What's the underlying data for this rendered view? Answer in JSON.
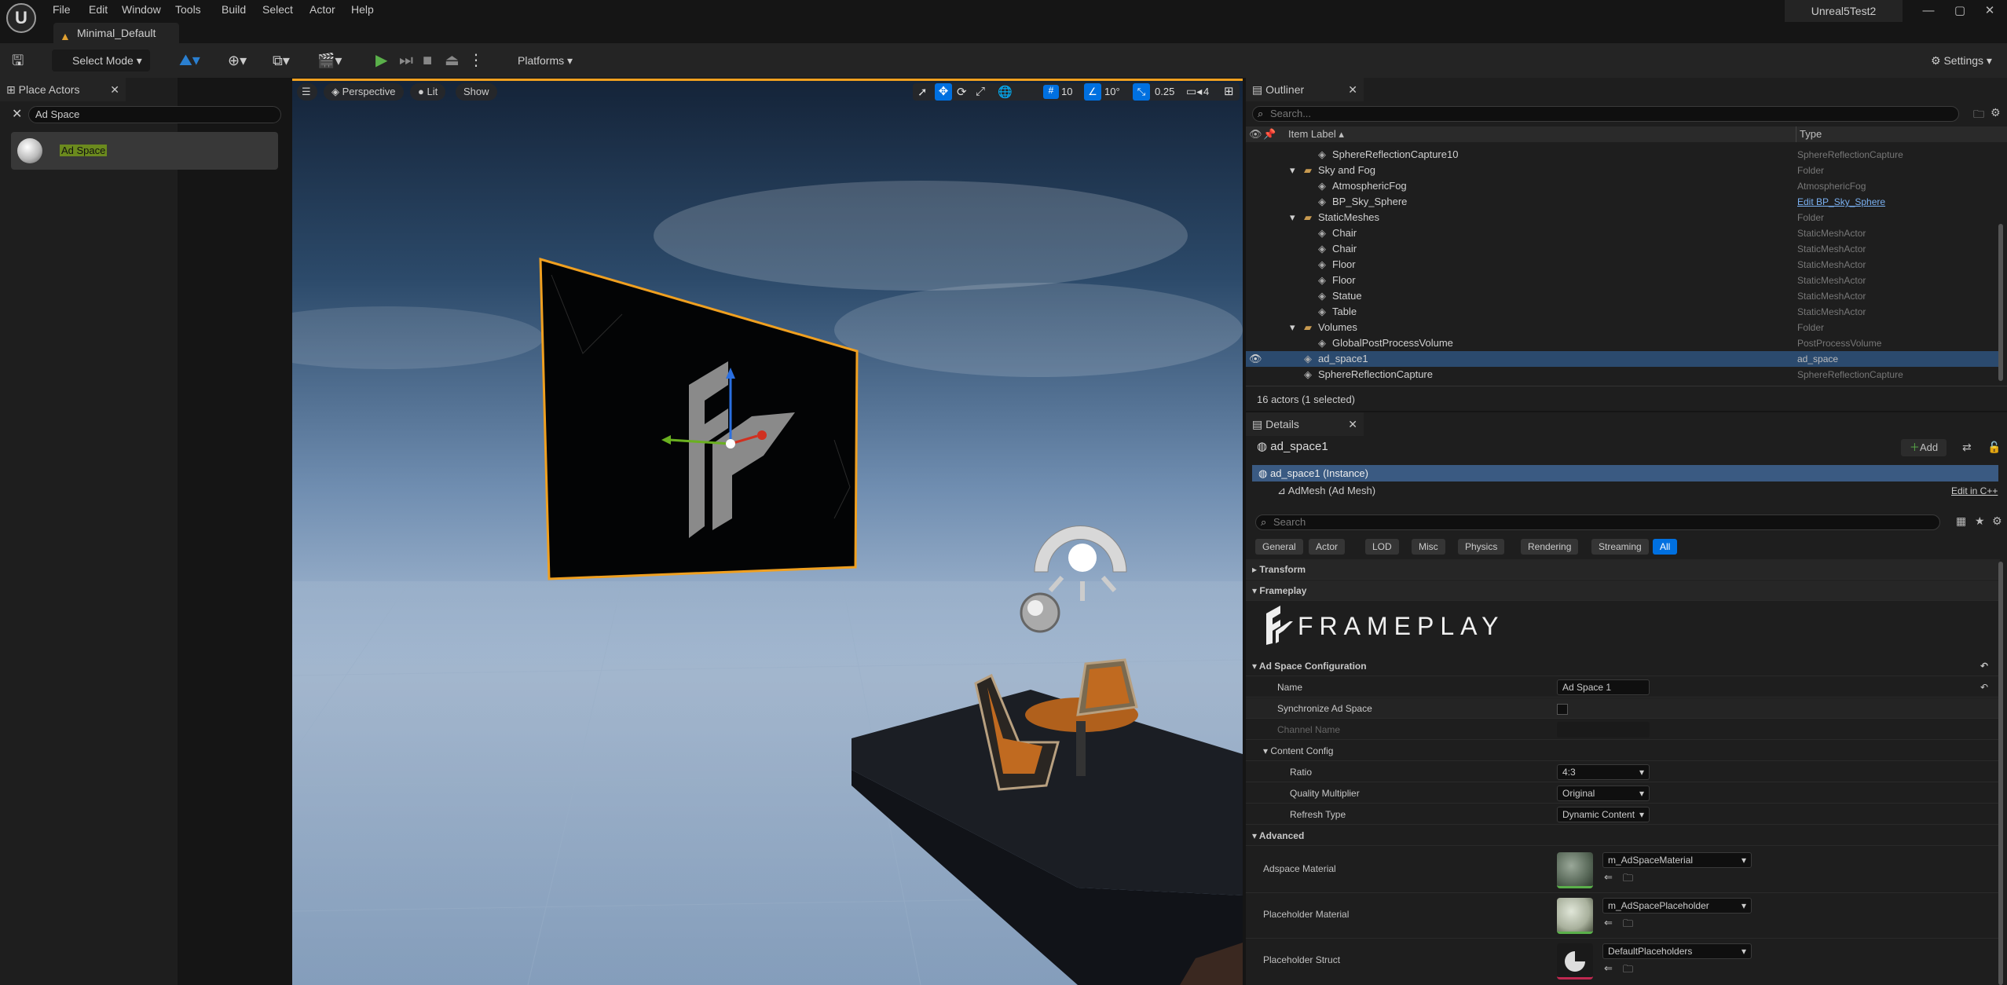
{
  "app": {
    "title": "Unreal5Test2",
    "document_tab": "Minimal_Default"
  },
  "menu": [
    "File",
    "Edit",
    "Window",
    "Tools",
    "Build",
    "Select",
    "Actor",
    "Help"
  ],
  "window_controls": {
    "minimize": "—",
    "maximize": "▢",
    "close": "✕"
  },
  "toolbar": {
    "select_mode": "Select Mode",
    "platforms": "Platforms",
    "settings": "Settings"
  },
  "place_actors": {
    "tab_label": "Place Actors",
    "search_value": "Ad Space",
    "results": [
      {
        "label": "Ad Space"
      }
    ]
  },
  "viewport": {
    "perspective": "Perspective",
    "lit": "Lit",
    "show": "Show",
    "grid_snap": "10",
    "rotation_snap": "10°",
    "scale_snap": "0.25",
    "camera_speed": "4"
  },
  "outliner": {
    "tab_label": "Outliner",
    "search_placeholder": "Search...",
    "col_label": "Item Label ▴",
    "col_type": "Type",
    "rows": [
      {
        "label": "SphereReflectionCapture10",
        "type": "SphereReflectionCapture",
        "depth": 2,
        "kind": "actor"
      },
      {
        "label": "Sky and Fog",
        "type": "Folder",
        "depth": 1,
        "kind": "folder"
      },
      {
        "label": "AtmosphericFog",
        "type": "AtmosphericFog",
        "depth": 2,
        "kind": "actor"
      },
      {
        "label": "BP_Sky_Sphere",
        "type": "Edit BP_Sky_Sphere",
        "depth": 2,
        "kind": "actor",
        "type_link": true
      },
      {
        "label": "StaticMeshes",
        "type": "Folder",
        "depth": 1,
        "kind": "folder"
      },
      {
        "label": "Chair",
        "type": "StaticMeshActor",
        "depth": 2,
        "kind": "actor"
      },
      {
        "label": "Chair",
        "type": "StaticMeshActor",
        "depth": 2,
        "kind": "actor"
      },
      {
        "label": "Floor",
        "type": "StaticMeshActor",
        "depth": 2,
        "kind": "actor"
      },
      {
        "label": "Floor",
        "type": "StaticMeshActor",
        "depth": 2,
        "kind": "actor"
      },
      {
        "label": "Statue",
        "type": "StaticMeshActor",
        "depth": 2,
        "kind": "actor"
      },
      {
        "label": "Table",
        "type": "StaticMeshActor",
        "depth": 2,
        "kind": "actor"
      },
      {
        "label": "Volumes",
        "type": "Folder",
        "depth": 1,
        "kind": "folder"
      },
      {
        "label": "GlobalPostProcessVolume",
        "type": "PostProcessVolume",
        "depth": 2,
        "kind": "actor"
      },
      {
        "label": "ad_space1",
        "type": "ad_space",
        "depth": 1,
        "kind": "actor",
        "selected": true
      },
      {
        "label": "SphereReflectionCapture",
        "type": "SphereReflectionCapture",
        "depth": 1,
        "kind": "actor"
      }
    ],
    "status": "16 actors (1 selected)"
  },
  "details": {
    "tab_label": "Details",
    "actor_name": "ad_space1",
    "add_label": "Add",
    "instance_label": "ad_space1 (Instance)",
    "component_label": "AdMesh (Ad Mesh)",
    "edit_cpp": "Edit in C++",
    "search_placeholder": "Search",
    "categories": [
      "General",
      "Actor",
      "LOD",
      "Misc",
      "Physics",
      "Rendering",
      "Streaming",
      "All"
    ],
    "active_category": "All",
    "sections": {
      "transform": "Transform",
      "frameplay": "Frameplay",
      "ad_space_config": "Ad Space Configuration",
      "content_config": "Content Config",
      "advanced": "Advanced"
    },
    "frameplay_logo_text": "FRAMEPLAY",
    "props": {
      "name_label": "Name",
      "name_value": "Ad Space 1",
      "sync_label": "Synchronize Ad Space",
      "channel_label": "Channel Name",
      "ratio_label": "Ratio",
      "ratio_value": "4:3",
      "quality_label": "Quality Multiplier",
      "quality_value": "Original",
      "refresh_label": "Refresh Type",
      "refresh_value": "Dynamic Content",
      "adspace_mat_label": "Adspace Material",
      "adspace_mat_value": "m_AdSpaceMaterial",
      "placeholder_mat_label": "Placeholder Material",
      "placeholder_mat_value": "m_AdSpacePlaceholder",
      "placeholder_struct_label": "Placeholder Struct",
      "placeholder_struct_value": "DefaultPlaceholders"
    }
  },
  "colors": {
    "accent": "#0070e0",
    "selection": "#2b4a6e",
    "play_green": "#5ab04a",
    "folder": "#c89a50",
    "billboard_outline": "#f0a020"
  }
}
